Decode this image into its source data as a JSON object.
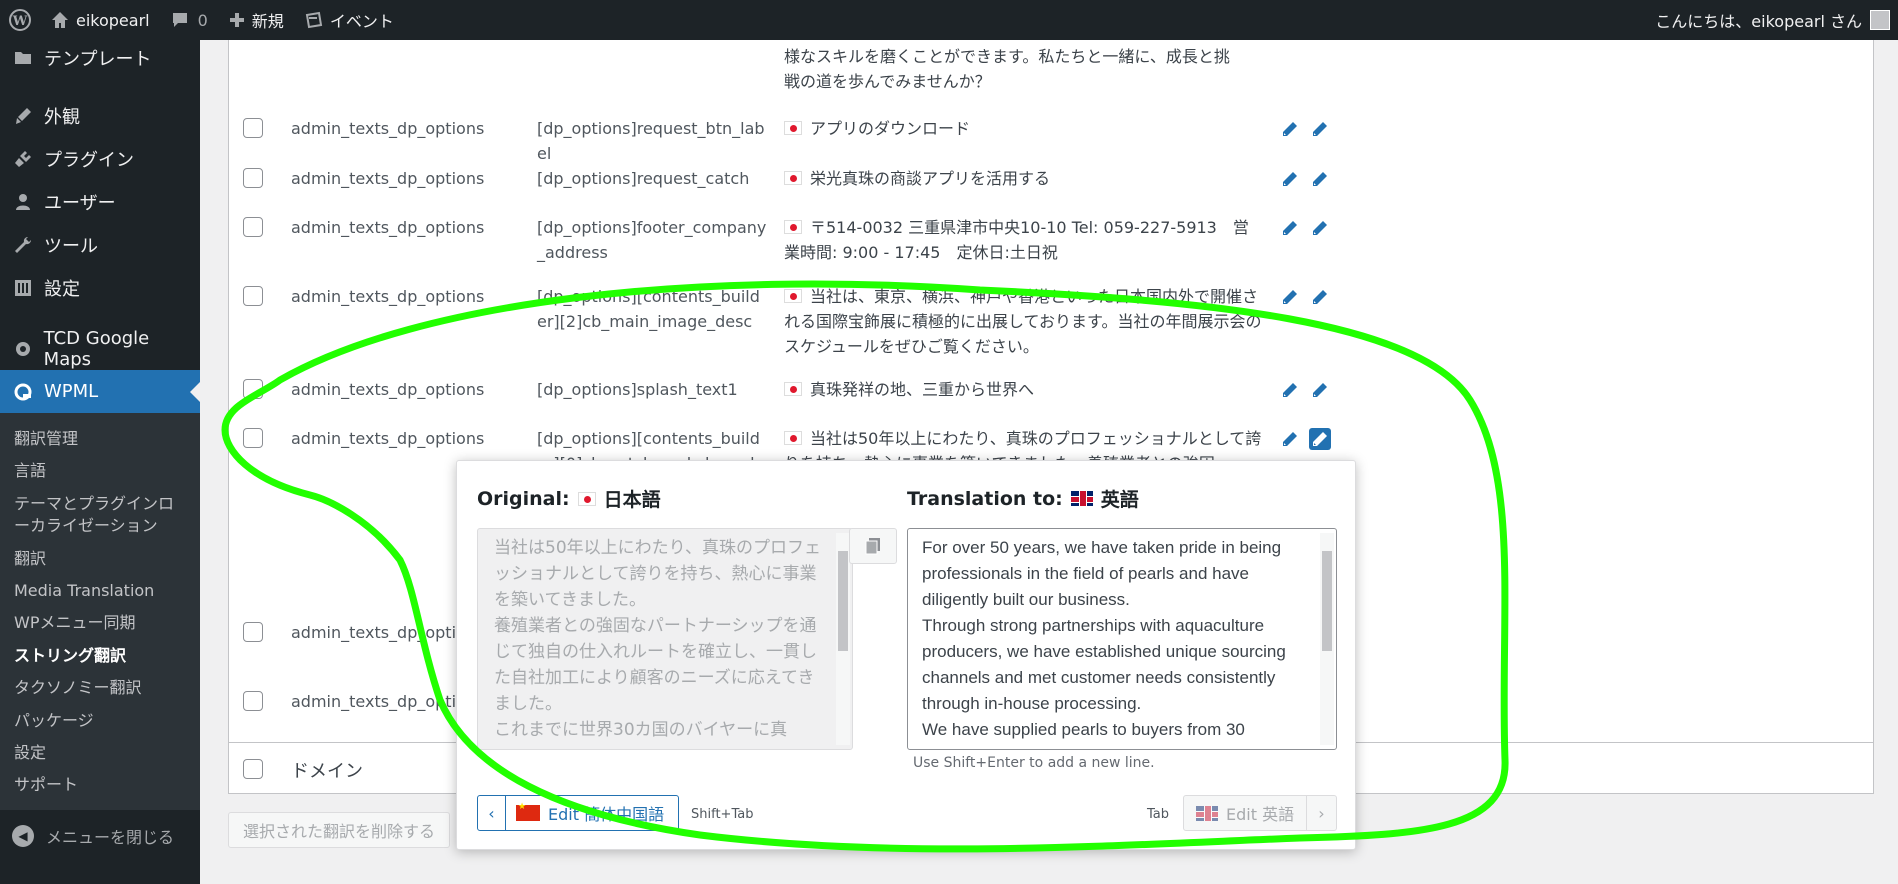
{
  "adminbar": {
    "site_name": "eikopearl",
    "comments_count": "0",
    "new_label": "新規",
    "event_label": "イベント",
    "greeting": "こんにちは、eikopearl さん"
  },
  "sidebar": {
    "items": [
      {
        "label": "テンプレート",
        "icon": "template-icon"
      },
      {
        "label": "外観",
        "icon": "appearance-brush-icon"
      },
      {
        "label": "プラグイン",
        "icon": "plugins-icon"
      },
      {
        "label": "ユーザー",
        "icon": "users-icon"
      },
      {
        "label": "ツール",
        "icon": "tools-wrench-icon"
      },
      {
        "label": "設定",
        "icon": "settings-icon"
      },
      {
        "label": "TCD Google Maps",
        "icon": "gear-icon"
      },
      {
        "label": "WPML",
        "icon": "wpml-icon"
      }
    ],
    "submenu": [
      "翻訳管理",
      "言語",
      "テーマとプラグインローカライゼーション",
      "翻訳",
      "Media Translation",
      "WPメニュー同期",
      "ストリング翻訳",
      "タクソノミー翻訳",
      "パッケージ",
      "設定",
      "サポート"
    ],
    "collapse_label": "メニューを閉じる"
  },
  "table": {
    "top_fragment": [
      "様なスキルを磨くことができます。私たちと一緒に、成長と挑",
      "戦の道を歩んでみませんか？"
    ],
    "rows": [
      {
        "context": "admin_texts_dp_options",
        "name": "[dp_options]request_btn_label",
        "value": "アプリのダウンロード"
      },
      {
        "context": "admin_texts_dp_options",
        "name": "[dp_options]request_catch",
        "value": "栄光真珠の商談アプリを活用する"
      },
      {
        "context": "admin_texts_dp_options",
        "name": "[dp_options]footer_company_address",
        "value": "〒514-0032 三重県津市中央10-10 Tel: 059-227-5913　営業時間: 9:00 - 17:45　定休日:土日祝"
      },
      {
        "context": "admin_texts_dp_options",
        "name": "[dp_options][contents_builder][2]cb_main_image_desc",
        "value": "当社は、東京、横浜、神戸や香港といった日本国内外で開催される国際宝飾展に積極的に出展しております。当社の年間展示会のスケジュールをぜひご覧ください。"
      },
      {
        "context": "admin_texts_dp_options",
        "name": "[dp_options]splash_text1",
        "value": "真珠発祥の地、三重から世界へ"
      },
      {
        "context": "admin_texts_dp_options",
        "name": "[dp_options][contents_builder][0]cb_catch_and_desc_desc",
        "value": "当社は50年以上にわたり、真珠のプロフェッショナルとして誇りを持ち、熱心に事業を築いてきました。養殖業者との強固"
      }
    ],
    "lower_rows": [
      {
        "context": "admin_texts_dp_option"
      },
      {
        "context": "admin_texts_dp_option"
      }
    ],
    "domain_label": "ドメイン",
    "delete_button": "選択された翻訳を削除する"
  },
  "popup": {
    "original_label": "Original:",
    "original_lang": "日本語",
    "translation_label": "Translation to:",
    "translation_lang": "英語",
    "original_text": "当社は50年以上にわたり、真珠のプロフェッショナルとして誇りを持ち、熱心に事業を築いてきました。\n養殖業者との強固なパートナーシップを通じて独自の仕入れルートを確立し、一貫した自社加工により顧客のニーズに応えてきました。\nこれまでに世界30カ国のバイヤーに真",
    "translation_text": "For over 50 years, we have taken pride in being professionals in the field of pearls and have diligently built our business.\nThrough strong partnerships with aquaculture producers, we have established unique sourcing channels and met customer needs consistently through in-house processing.\nWe have supplied pearls to buyers from 30",
    "hint": "Use Shift+Enter to add a new line.",
    "prev_button": "Edit 簡体中国語",
    "prev_shortcut": "Shift+Tab",
    "next_shortcut": "Tab",
    "next_button": "Edit 英語"
  },
  "colors": {
    "accent": "#2271b1",
    "annotation": "#22ff00",
    "adminbar_bg": "#1d2327"
  }
}
